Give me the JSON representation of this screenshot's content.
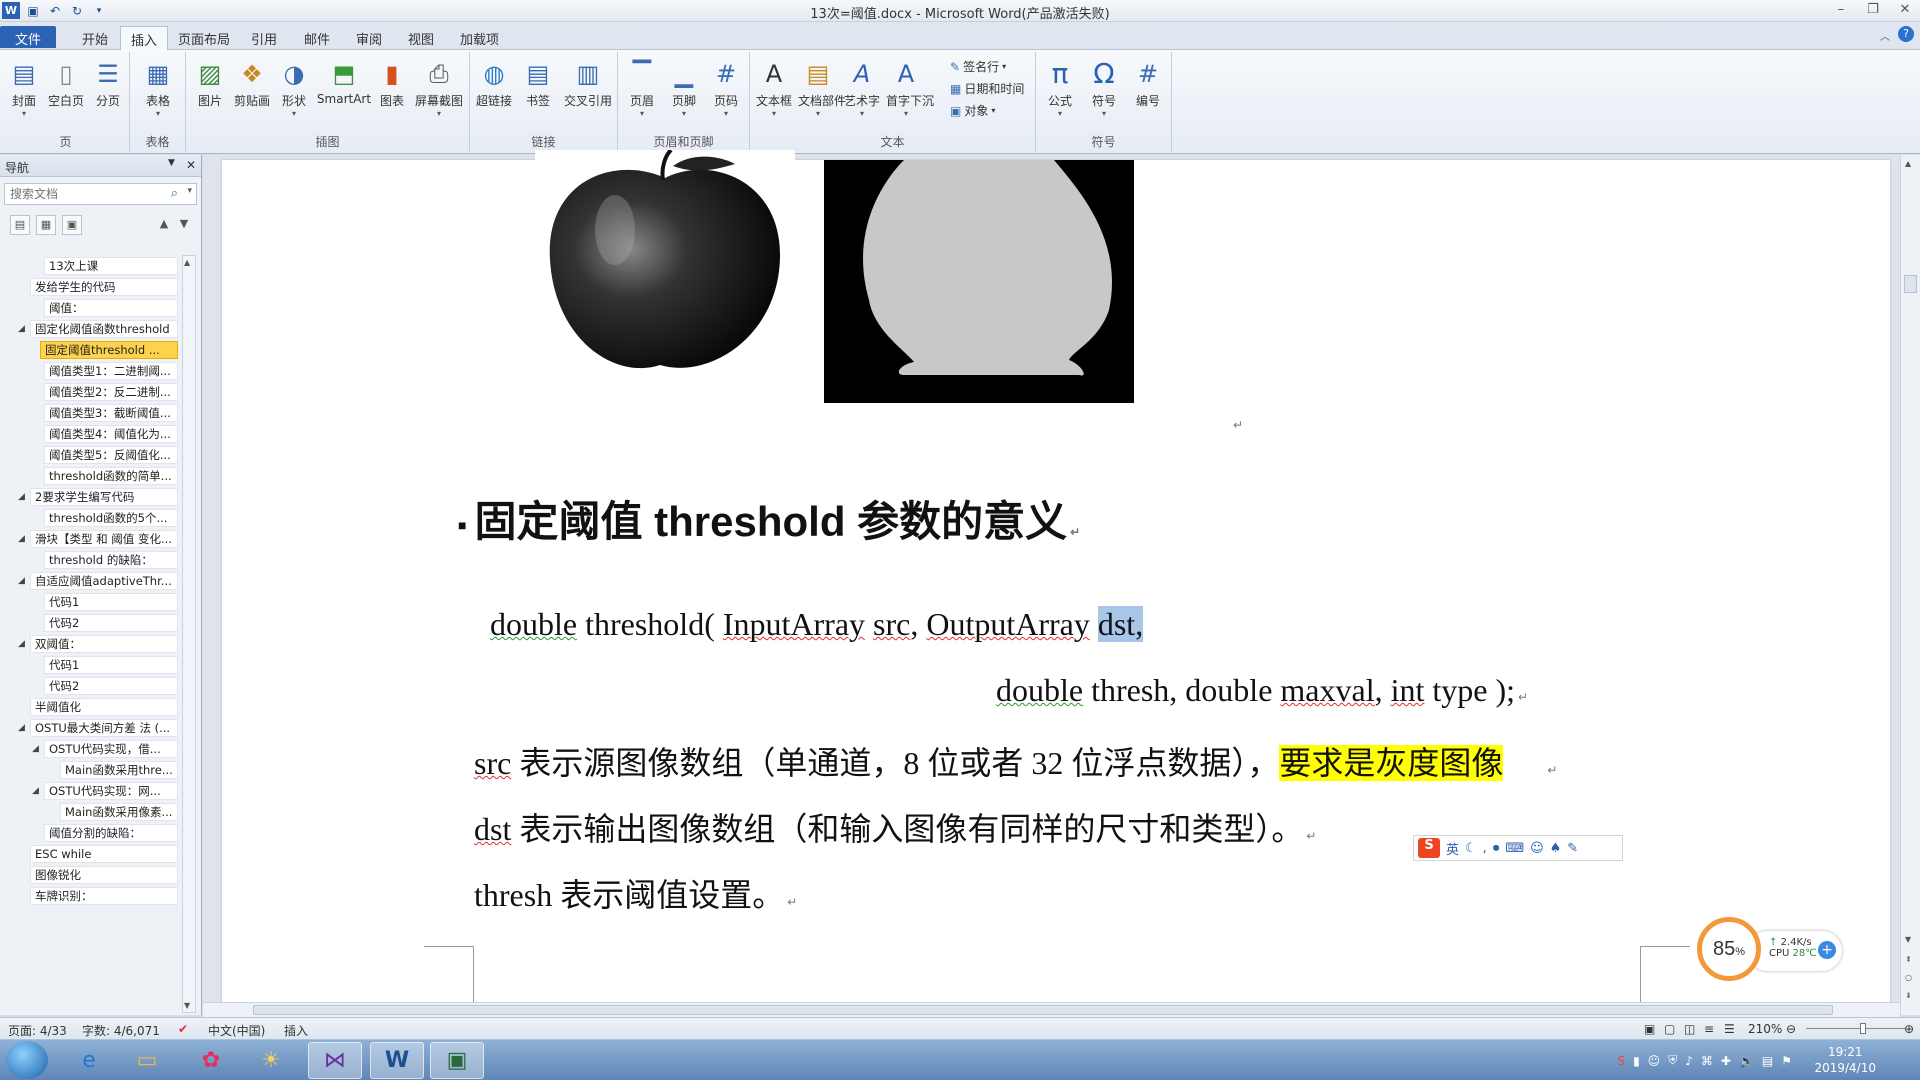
{
  "window": {
    "title": "13次=阈值.docx - Microsoft Word(产品激活失败)",
    "controls": [
      "minimize-icon",
      "restore-icon",
      "close-icon"
    ]
  },
  "ribbon_tabs": [
    "文件",
    "开始",
    "插入",
    "页面布局",
    "引用",
    "邮件",
    "审阅",
    "视图",
    "加载项"
  ],
  "ribbon": {
    "groups": {
      "page": "页",
      "table": "表格",
      "illustrations": "插图",
      "links": "链接",
      "header_footer": "页眉和页脚",
      "text": "文本",
      "symbols": "符号"
    },
    "buttons": {
      "cover": "封面",
      "blank": "空白页",
      "pagebreak": "分页",
      "table": "表格",
      "picture": "图片",
      "clipart": "剪贴画",
      "shapes": "形状",
      "smartart": "SmartArt",
      "chart": "图表",
      "screenshot": "屏幕截图",
      "hyperlink": "超链接",
      "bookmark": "书签",
      "crossref": "交叉引用",
      "header": "页眉",
      "footer": "页脚",
      "pagenum": "页码",
      "textbox": "文本框",
      "quickparts": "文档部件",
      "wordart": "艺术字",
      "dropcap": "首字下沉",
      "signature": "签名行",
      "datetime": "日期和时间",
      "object": "对象",
      "equation": "公式",
      "symbol": "符号",
      "number": "编号"
    }
  },
  "nav": {
    "title": "导航",
    "search_placeholder": "搜索文档",
    "items": [
      "13次上课",
      "发给学生的代码",
      "阈值：",
      "固定化阈值函数threshold",
      "固定阈值threshold ...",
      "阈值类型1：二进制阈...",
      "阈值类型2：反二进制...",
      "阈值类型3：截断阈值...",
      "阈值类型4：阈值化为...",
      "阈值类型5：反阈值化...",
      "threshold函数的简单...",
      "2要求学生编写代码",
      "threshold函数的5个...",
      "滑块【类型 和 阈值 变化...",
      "threshold 的缺陷：",
      "自适应阈值adaptiveThr...",
      "代码1",
      "代码2",
      "双阈值：",
      "代码1",
      "代码2",
      "半阈值化",
      "OSTU最大类间方差 法 (...",
      "OSTU代码实现，借...",
      "Main函数采用thre...",
      "OSTU代码实现：网...",
      "Main函数采用像素...",
      "阈值分割的缺陷：",
      "ESC while",
      "图像锐化",
      "车牌识别："
    ]
  },
  "document": {
    "heading": "固定阈值 threshold  参数的意义",
    "sig_line1": {
      "t1": "double",
      "t2": " threshold( ",
      "t3": "InputArray",
      "t4": " ",
      "t5": "src",
      "t6": ", ",
      "t7": "OutputArray",
      "t8": " ",
      "t9": "dst,"
    },
    "sig_line2": {
      "t1": "double",
      "t2": " thresh, double ",
      "t3": "maxval",
      "t4": ", ",
      "t5": "int",
      "t6": " type );"
    },
    "line_src": {
      "t1": "src",
      "t2": " 表示源图像数组（单通道，8 位或者 32 位浮点数据），",
      "t3": "要求是灰度图像"
    },
    "line_dst": {
      "t1": "dst",
      "t2": " 表示输出图像数组（和输入图像有同样的尺寸和类型）。"
    },
    "line_thresh": {
      "t1": "thresh 表示阈值设置。"
    }
  },
  "ime": {
    "logo": "S",
    "mode": "英"
  },
  "cpu_widget": {
    "percent": "85",
    "percent_unit": "%",
    "net": "2.4K/s",
    "cpu_label": "CPU",
    "temp": "28℃"
  },
  "status": {
    "page": "页面: 4/33",
    "words": "字数: 4/6,071",
    "language": "中文(中国)",
    "mode": "插入",
    "zoom": "210%"
  },
  "taskbar": {
    "time": "19:21",
    "date": "2019/4/10"
  },
  "colors": {
    "file_tab": "#2b62b3",
    "nav_selected": "#ffd24d",
    "highlight_yellow": "#ffff00",
    "selection_blue": "#a8c6e8",
    "spell_red": "#e03030"
  }
}
